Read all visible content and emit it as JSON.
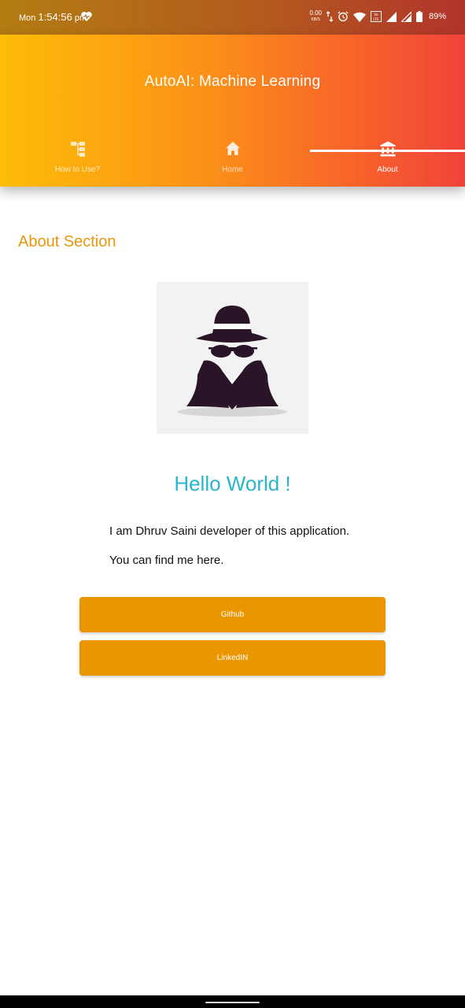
{
  "status_bar": {
    "day": "Mon",
    "time": "1:54:56",
    "ampm": "pm",
    "net_speed": "0.00",
    "net_unit": "KB/S",
    "battery": "89%",
    "icons": [
      "heart-rate-icon",
      "data-arrows-icon",
      "alarm-icon",
      "wifi-icon",
      "volte-icon",
      "signal-icon",
      "signal-alt-icon",
      "battery-icon"
    ]
  },
  "app_bar": {
    "title": "AutoAI: Machine Learning",
    "tabs": [
      {
        "label": "How to Use?",
        "icon": "tree-structure-icon",
        "active": false
      },
      {
        "label": "Home",
        "icon": "home-icon",
        "active": false
      },
      {
        "label": "About",
        "icon": "bank-building-icon",
        "active": true
      }
    ]
  },
  "about": {
    "section_title": "About Section",
    "avatar": "spy-incognito-avatar",
    "greeting": "Hello World !",
    "line1": "I am Dhruv Saini developer of this application.",
    "line2": "You can find me here.",
    "github_label": "Github",
    "linkedin_label": "LinkedIN"
  },
  "colors": {
    "accent": "#ea9600",
    "section_title": "#e8960b",
    "greeting": "#29b5cc",
    "appbar_start": "#fdbd08",
    "appbar_end": "#f0433a"
  }
}
